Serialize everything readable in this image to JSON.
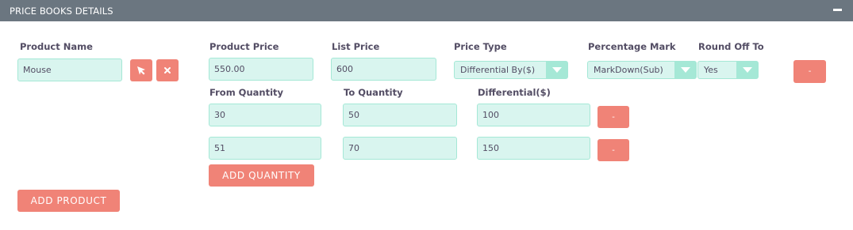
{
  "header": {
    "title": "PRICE BOOKS DETAILS"
  },
  "labels": {
    "product_name": "Product Name",
    "product_price": "Product Price",
    "list_price": "List Price",
    "price_type": "Price Type",
    "percentage_mark": "Percentage Mark",
    "round_off_to": "Round Off To",
    "from_quantity": "From Quantity",
    "to_quantity": "To Quantity",
    "differential": "Differential($)"
  },
  "product": {
    "name": "Mouse",
    "price": "550.00",
    "list_price": "600",
    "price_type": "Differential By($)",
    "percentage_mark": "MarkDown(Sub)",
    "round_off_to": "Yes",
    "remove_label": "-"
  },
  "quantities": [
    {
      "from": "30",
      "to": "50",
      "differential": "100",
      "remove_label": "-"
    },
    {
      "from": "51",
      "to": "70",
      "differential": "150",
      "remove_label": "-"
    }
  ],
  "buttons": {
    "add_quantity": "ADD QUANTITY",
    "add_product": "ADD PRODUCT"
  },
  "icons": {
    "select": "cursor-arrow-icon",
    "clear": "close-icon",
    "collapse": "minus-icon"
  },
  "colors": {
    "header_bg": "#6b7680",
    "input_bg": "#d9f5ef",
    "input_border": "#a5e8d6",
    "button_red": "#f08377"
  }
}
